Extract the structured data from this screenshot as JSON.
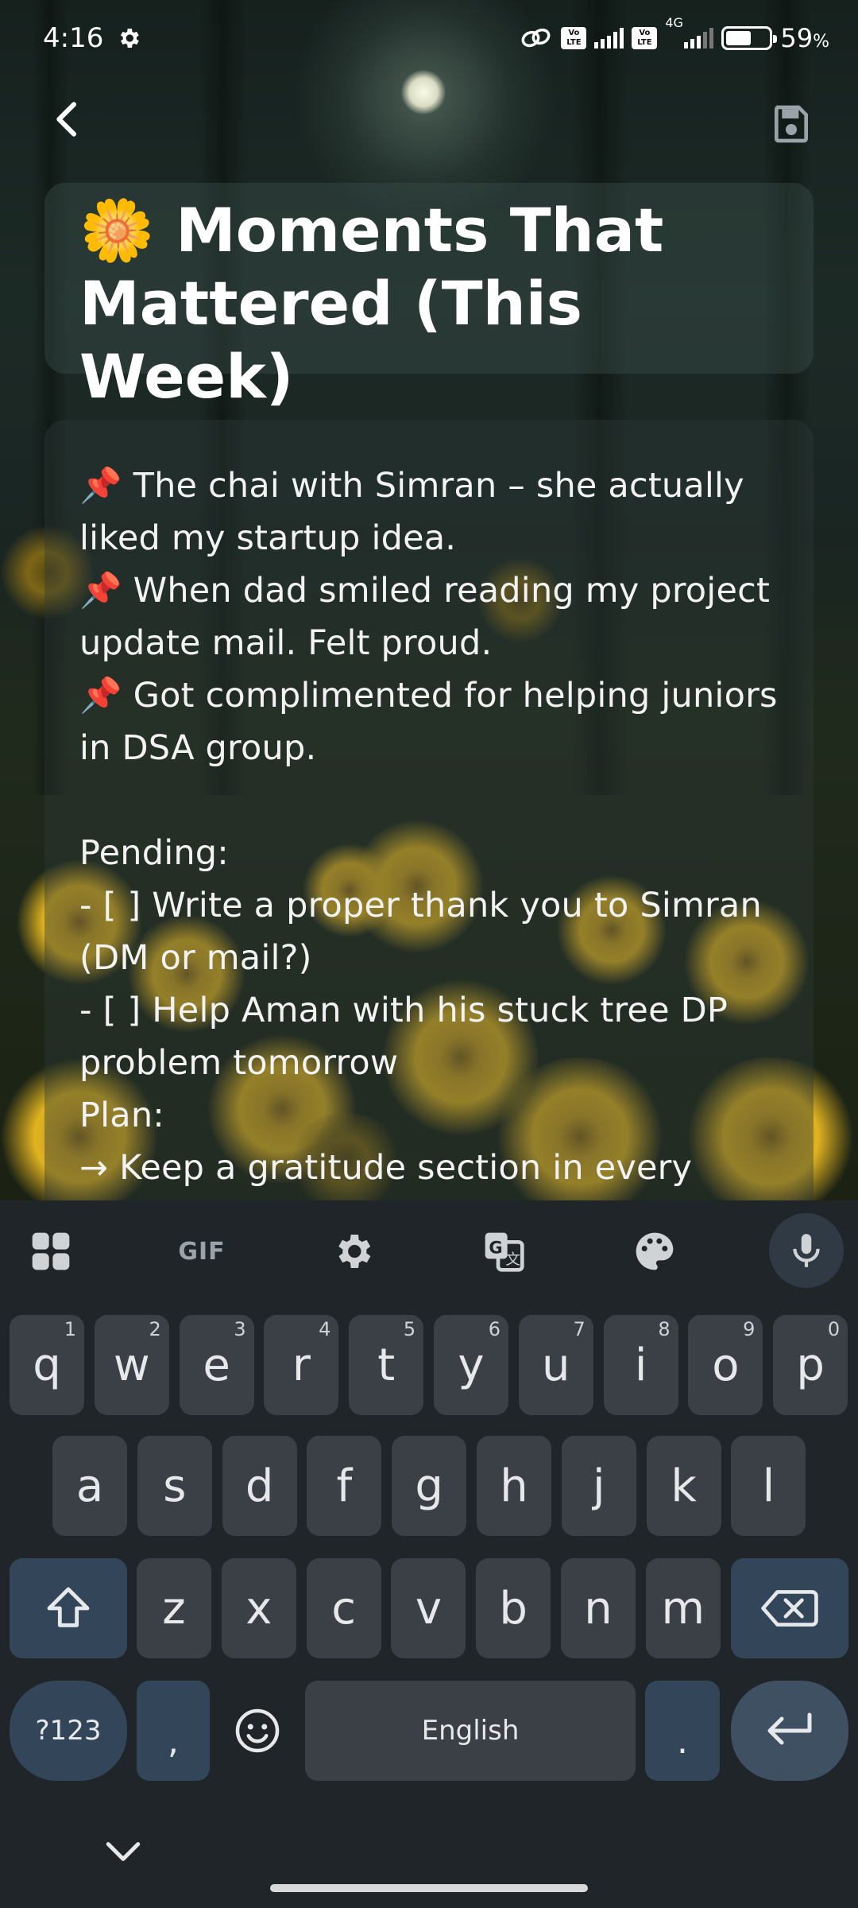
{
  "status_bar": {
    "time": "4:16",
    "volte_1": "Vo LTE",
    "volte_2": "Vo LTE",
    "network": "4G",
    "battery_percent": "59",
    "battery_unit": "%"
  },
  "note": {
    "title": "🌼 Moments That Mattered (This Week)",
    "body": "📌 The chai with Simran – she actually liked my startup idea.\n📌 When dad smiled reading my project update mail. Felt proud.\n📌 Got complimented for helping juniors in DSA group.\n\nPending:\n- [ ] Write a proper thank you to Simran (DM or mail?)\n- [ ] Help Aman with his stuck tree DP problem tomorrow\nPlan:\n→ Keep a gratitude section in every"
  },
  "keyboard": {
    "toolbar": {
      "gif": "GIF"
    },
    "row1": [
      {
        "label": "q",
        "hint": "1"
      },
      {
        "label": "w",
        "hint": "2"
      },
      {
        "label": "e",
        "hint": "3"
      },
      {
        "label": "r",
        "hint": "4"
      },
      {
        "label": "t",
        "hint": "5"
      },
      {
        "label": "y",
        "hint": "6"
      },
      {
        "label": "u",
        "hint": "7"
      },
      {
        "label": "i",
        "hint": "8"
      },
      {
        "label": "o",
        "hint": "9"
      },
      {
        "label": "p",
        "hint": "0"
      }
    ],
    "row2": [
      "a",
      "s",
      "d",
      "f",
      "g",
      "h",
      "j",
      "k",
      "l"
    ],
    "row3": [
      "z",
      "x",
      "c",
      "v",
      "b",
      "n",
      "m"
    ],
    "symbols_label": "?123",
    "comma": ",",
    "space_label": "English",
    "period": "."
  },
  "icons": {
    "status": [
      "settings-icon",
      "link-icon",
      "signal-icon",
      "battery-icon"
    ],
    "toolbar": [
      "apps-grid-icon",
      "gif-icon",
      "settings-icon",
      "translate-icon",
      "palette-icon",
      "mic-icon"
    ],
    "actions": [
      "back-arrow-icon",
      "save-icon",
      "shift-icon",
      "backspace-icon",
      "emoji-icon",
      "enter-icon",
      "chevron-down-icon"
    ]
  }
}
